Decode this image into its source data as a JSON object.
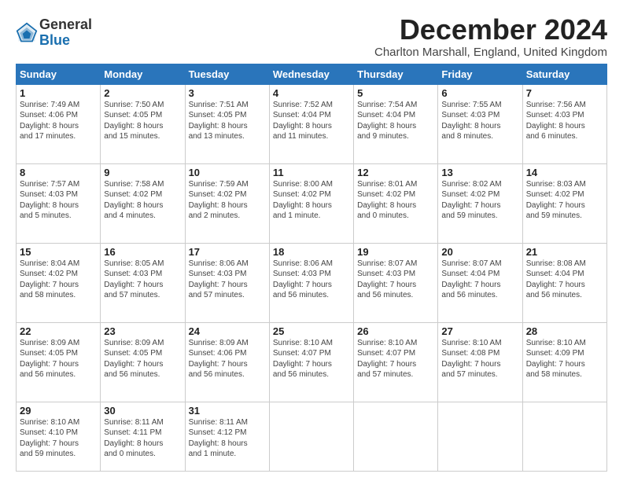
{
  "header": {
    "logo_general": "General",
    "logo_blue": "Blue",
    "month_title": "December 2024",
    "location": "Charlton Marshall, England, United Kingdom"
  },
  "weekdays": [
    "Sunday",
    "Monday",
    "Tuesday",
    "Wednesday",
    "Thursday",
    "Friday",
    "Saturday"
  ],
  "weeks": [
    [
      {
        "day": "1",
        "info": "Sunrise: 7:49 AM\nSunset: 4:06 PM\nDaylight: 8 hours\nand 17 minutes."
      },
      {
        "day": "2",
        "info": "Sunrise: 7:50 AM\nSunset: 4:05 PM\nDaylight: 8 hours\nand 15 minutes."
      },
      {
        "day": "3",
        "info": "Sunrise: 7:51 AM\nSunset: 4:05 PM\nDaylight: 8 hours\nand 13 minutes."
      },
      {
        "day": "4",
        "info": "Sunrise: 7:52 AM\nSunset: 4:04 PM\nDaylight: 8 hours\nand 11 minutes."
      },
      {
        "day": "5",
        "info": "Sunrise: 7:54 AM\nSunset: 4:04 PM\nDaylight: 8 hours\nand 9 minutes."
      },
      {
        "day": "6",
        "info": "Sunrise: 7:55 AM\nSunset: 4:03 PM\nDaylight: 8 hours\nand 8 minutes."
      },
      {
        "day": "7",
        "info": "Sunrise: 7:56 AM\nSunset: 4:03 PM\nDaylight: 8 hours\nand 6 minutes."
      }
    ],
    [
      {
        "day": "8",
        "info": "Sunrise: 7:57 AM\nSunset: 4:03 PM\nDaylight: 8 hours\nand 5 minutes."
      },
      {
        "day": "9",
        "info": "Sunrise: 7:58 AM\nSunset: 4:02 PM\nDaylight: 8 hours\nand 4 minutes."
      },
      {
        "day": "10",
        "info": "Sunrise: 7:59 AM\nSunset: 4:02 PM\nDaylight: 8 hours\nand 2 minutes."
      },
      {
        "day": "11",
        "info": "Sunrise: 8:00 AM\nSunset: 4:02 PM\nDaylight: 8 hours\nand 1 minute."
      },
      {
        "day": "12",
        "info": "Sunrise: 8:01 AM\nSunset: 4:02 PM\nDaylight: 8 hours\nand 0 minutes."
      },
      {
        "day": "13",
        "info": "Sunrise: 8:02 AM\nSunset: 4:02 PM\nDaylight: 7 hours\nand 59 minutes."
      },
      {
        "day": "14",
        "info": "Sunrise: 8:03 AM\nSunset: 4:02 PM\nDaylight: 7 hours\nand 59 minutes."
      }
    ],
    [
      {
        "day": "15",
        "info": "Sunrise: 8:04 AM\nSunset: 4:02 PM\nDaylight: 7 hours\nand 58 minutes."
      },
      {
        "day": "16",
        "info": "Sunrise: 8:05 AM\nSunset: 4:03 PM\nDaylight: 7 hours\nand 57 minutes."
      },
      {
        "day": "17",
        "info": "Sunrise: 8:06 AM\nSunset: 4:03 PM\nDaylight: 7 hours\nand 57 minutes."
      },
      {
        "day": "18",
        "info": "Sunrise: 8:06 AM\nSunset: 4:03 PM\nDaylight: 7 hours\nand 56 minutes."
      },
      {
        "day": "19",
        "info": "Sunrise: 8:07 AM\nSunset: 4:03 PM\nDaylight: 7 hours\nand 56 minutes."
      },
      {
        "day": "20",
        "info": "Sunrise: 8:07 AM\nSunset: 4:04 PM\nDaylight: 7 hours\nand 56 minutes."
      },
      {
        "day": "21",
        "info": "Sunrise: 8:08 AM\nSunset: 4:04 PM\nDaylight: 7 hours\nand 56 minutes."
      }
    ],
    [
      {
        "day": "22",
        "info": "Sunrise: 8:09 AM\nSunset: 4:05 PM\nDaylight: 7 hours\nand 56 minutes."
      },
      {
        "day": "23",
        "info": "Sunrise: 8:09 AM\nSunset: 4:05 PM\nDaylight: 7 hours\nand 56 minutes."
      },
      {
        "day": "24",
        "info": "Sunrise: 8:09 AM\nSunset: 4:06 PM\nDaylight: 7 hours\nand 56 minutes."
      },
      {
        "day": "25",
        "info": "Sunrise: 8:10 AM\nSunset: 4:07 PM\nDaylight: 7 hours\nand 56 minutes."
      },
      {
        "day": "26",
        "info": "Sunrise: 8:10 AM\nSunset: 4:07 PM\nDaylight: 7 hours\nand 57 minutes."
      },
      {
        "day": "27",
        "info": "Sunrise: 8:10 AM\nSunset: 4:08 PM\nDaylight: 7 hours\nand 57 minutes."
      },
      {
        "day": "28",
        "info": "Sunrise: 8:10 AM\nSunset: 4:09 PM\nDaylight: 7 hours\nand 58 minutes."
      }
    ],
    [
      {
        "day": "29",
        "info": "Sunrise: 8:10 AM\nSunset: 4:10 PM\nDaylight: 7 hours\nand 59 minutes."
      },
      {
        "day": "30",
        "info": "Sunrise: 8:11 AM\nSunset: 4:11 PM\nDaylight: 8 hours\nand 0 minutes."
      },
      {
        "day": "31",
        "info": "Sunrise: 8:11 AM\nSunset: 4:12 PM\nDaylight: 8 hours\nand 1 minute."
      },
      null,
      null,
      null,
      null
    ]
  ]
}
